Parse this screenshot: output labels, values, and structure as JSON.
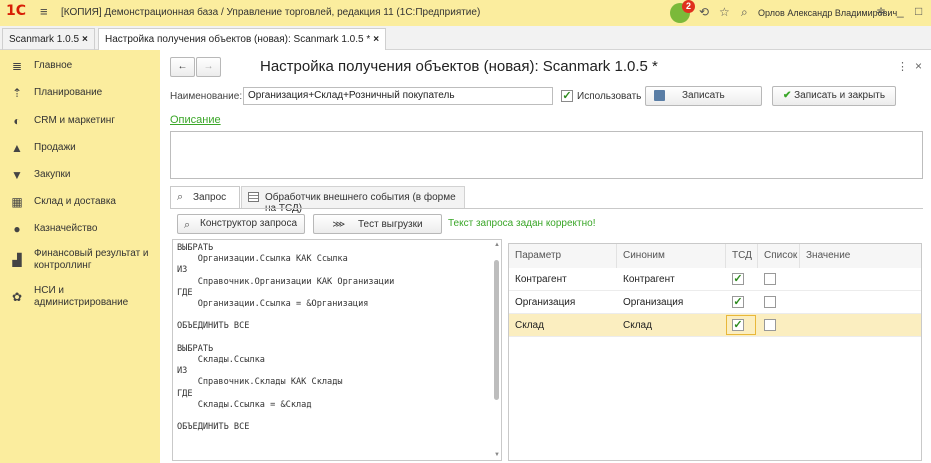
{
  "titlebar": {
    "logo": "1C",
    "title": "[КОПИЯ] Демонстрационная база / Управление торговлей, редакция 11  (1С:Предприятие)",
    "notification_count": "2",
    "user": "Орлов Александр Владимирович"
  },
  "tabs": [
    {
      "label": "Scanmark 1.0.5"
    },
    {
      "label": "Настройка получения объектов (новая): Scanmark 1.0.5 *"
    }
  ],
  "sidebar": {
    "items": [
      {
        "label": "Главное",
        "icon": "menu-icon"
      },
      {
        "label": "Планирование",
        "icon": "planning-icon"
      },
      {
        "label": "CRM и маркетинг",
        "icon": "crm-icon"
      },
      {
        "label": "Продажи",
        "icon": "sales-icon"
      },
      {
        "label": "Закупки",
        "icon": "cart-icon"
      },
      {
        "label": "Склад и доставка",
        "icon": "warehouse-icon"
      },
      {
        "label": "Казначейство",
        "icon": "treasury-icon"
      },
      {
        "label": "Финансовый результат и контроллинг",
        "icon": "chart-icon"
      },
      {
        "label": "НСИ и администрирование",
        "icon": "gear-icon"
      }
    ]
  },
  "form": {
    "title": "Настройка получения объектов (новая): Scanmark 1.0.5 *",
    "name_label": "Наименование:",
    "name_value": "Организация+Склад+Розничный покупатель",
    "use_label": "Использовать",
    "use_checked": true,
    "save_label": "Записать",
    "save_close_label": "Записать и закрыть",
    "description_link": "Описание",
    "description_value": ""
  },
  "inner_tabs": [
    {
      "label": "Запрос"
    },
    {
      "label": "Обработчик внешнего события (в форме на ТСД)"
    }
  ],
  "query_toolbar": {
    "constructor_label": "Конструктор запроса",
    "test_label": "Тест выгрузки",
    "status_text": "Текст запроса задан корректно!"
  },
  "query_text": "ВЫБРАТЬ\n    Организации.Ссылка КАК Ссылка\nИЗ\n    Справочник.Организации КАК Организации\nГДЕ\n    Организации.Ссылка = &Организация\n\nОБЪЕДИНИТЬ ВСЕ\n\nВЫБРАТЬ\n    Склады.Ссылка\nИЗ\n    Справочник.Склады КАК Склады\nГДЕ\n    Склады.Ссылка = &Склад\n\nОБЪЕДИНИТЬ ВСЕ",
  "params_table": {
    "columns": [
      "Параметр",
      "Синоним",
      "ТСД",
      "Список",
      "Значение"
    ],
    "rows": [
      {
        "param": "Контрагент",
        "synonym": "Контрагент",
        "tsd": true,
        "list": false,
        "value": ""
      },
      {
        "param": "Организация",
        "synonym": "Организация",
        "tsd": true,
        "list": false,
        "value": ""
      },
      {
        "param": "Склад",
        "synonym": "Склад",
        "tsd": true,
        "list": false,
        "value": "",
        "selected": true
      }
    ]
  },
  "colors": {
    "panel_yellow": "#fbed9e",
    "selected_row": "#fbeec0",
    "link_green": "#3aa628",
    "logo_red": "#d81e05"
  }
}
